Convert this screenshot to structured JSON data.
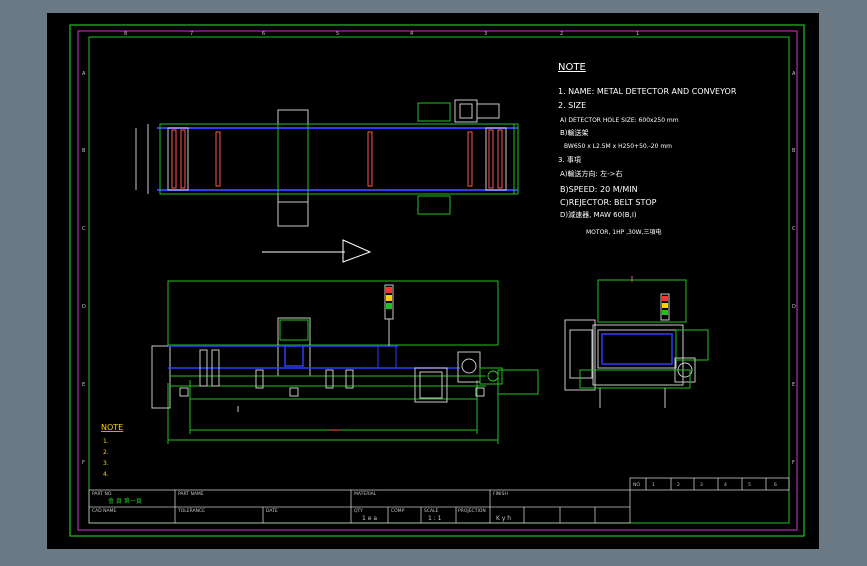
{
  "drawing": {
    "notes_heading": "NOTE",
    "notes": [
      "1. NAME: METAL DETECTOR AND CONVEYOR",
      "2. SIZE",
      "A) DETECTOR HOLE SIZE: 600x250 mm",
      "B)輸送架",
      "BW650 x L2.5M x H250+50.-20 mm",
      "3. 事項",
      "A)輸送方向: 左->右",
      "B)SPEED: 20 M/MIN",
      "C)REJECTOR: BELT STOP",
      "D)減速器, MAW 60(B,I)",
      "MOTOR, 1HP ,30W,三項电"
    ],
    "small_note": {
      "heading": "NOTE",
      "items": [
        "1.",
        "2.",
        "3.",
        "4."
      ]
    },
    "title_block": {
      "part_no_label": "PART NO.",
      "part_no_value": "會 頁 第一頁",
      "part_name_label": "PART NAME",
      "material_label": "MATERIAL",
      "finish_label": "FINISH",
      "cad_name_label": "CAD NAME",
      "tolerance_label": "TOLERANCE",
      "date_label": "DATE",
      "qty_label": "QTY",
      "qty_value": "1 e a",
      "comp_label": "COMP",
      "scale_label": "SCALE",
      "scale_value": "1 : 1",
      "projection_label": "PROJECTION",
      "designer_value": "K y h"
    },
    "revision_header": [
      "NO",
      "1",
      "2",
      "3",
      "4",
      "5",
      "6"
    ]
  }
}
